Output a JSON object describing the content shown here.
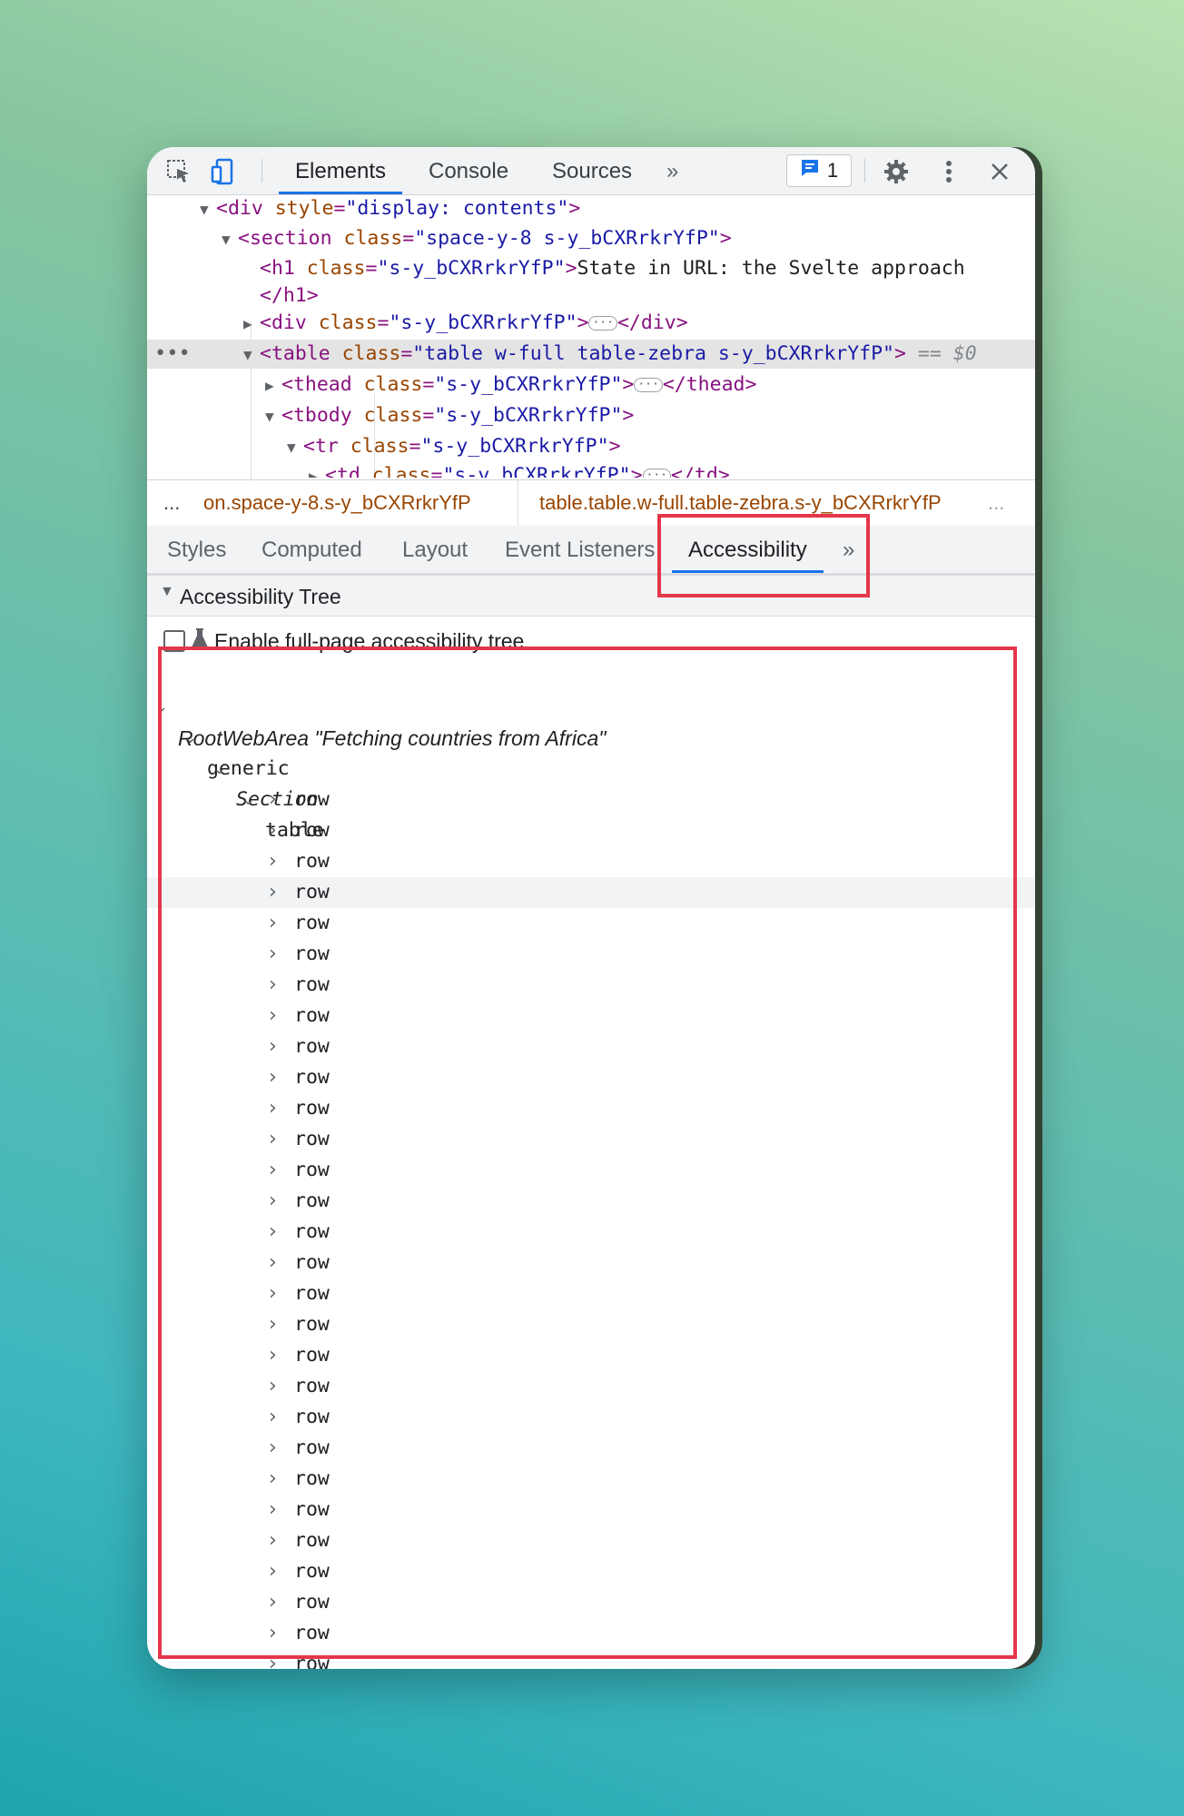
{
  "toolbar": {
    "tabs": [
      {
        "label": "Elements",
        "active": true
      },
      {
        "label": "Console",
        "active": false
      },
      {
        "label": "Sources",
        "active": false
      }
    ],
    "more_tabs_glyph": "»",
    "issues_count": "1",
    "icons": [
      "inspect-element-icon",
      "device-toolbar-icon",
      "issues-message-icon",
      "gear-icon",
      "kebab-menu-icon",
      "close-icon"
    ]
  },
  "dom": {
    "l1": {
      "tag_open": "<div ",
      "attr": "style",
      "val": "\"display: contents\"",
      "close": ">"
    },
    "l2": {
      "tag_open": "<section ",
      "attr": "class",
      "val": "\"space-y-8 s-y_bCXRrkrYfP\"",
      "close": ">"
    },
    "l3": {
      "tag_open": "<h1 ",
      "attr": "class",
      "val": "\"s-y_bCXRrkrYfP\"",
      "close": ">",
      "text": "State in URL: the Svelte approach"
    },
    "l3b": {
      "tag_close": "</h1>"
    },
    "l4": {
      "tag_open": "<div ",
      "attr": "class",
      "val": "\"s-y_bCXRrkrYfP\"",
      "close": ">",
      "ellipsis": "···",
      "end": "</div>"
    },
    "l5": {
      "tag_open": "<table ",
      "attr": "class",
      "val": "\"table w-full table-zebra s-y_bCXRrkrYfP\"",
      "close": ">",
      "eq": "== $0"
    },
    "l6": {
      "tag_open": "<thead ",
      "attr": "class",
      "val": "\"s-y_bCXRrkrYfP\"",
      "close": ">",
      "ellipsis": "···",
      "end": "</thead>"
    },
    "l7": {
      "tag_open": "<tbody ",
      "attr": "class",
      "val": "\"s-y_bCXRrkrYfP\"",
      "close": ">"
    },
    "l8": {
      "tag_open": "<tr ",
      "attr": "class",
      "val": "\"s-y_bCXRrkrYfP\"",
      "close": ">"
    },
    "l9": {
      "tag_open": "<td ",
      "attr": "class",
      "val": "\"s-y_bCXRrkrYfP\"",
      "close": ">",
      "ellipsis": "···",
      "end": "</td>"
    },
    "row_dots": "•••"
  },
  "breadcrumbs": {
    "left_dots": "...",
    "items": [
      "on.space-y-8.s-y_bCXRrkrYfP",
      "table.table.w-full.table-zebra.s-y_bCXRrkrYfP"
    ],
    "right_dots": "..."
  },
  "subtabs": [
    {
      "label": "Styles"
    },
    {
      "label": "Computed"
    },
    {
      "label": "Layout"
    },
    {
      "label": "Event Listeners"
    },
    {
      "label": "Accessibility",
      "active": true
    }
  ],
  "subtabs_more": "»",
  "accessibility_tree": {
    "header": "Accessibility Tree",
    "enable_label": "Enable full-page accessibility tree",
    "root": "RootWebArea \"Fetching countries from Africa\"",
    "generic": "generic",
    "section": "Section",
    "table": "table",
    "row_label": "row",
    "row_count_visible": 29
  },
  "colors": {
    "highlight_box": "#e5364a",
    "accent": "#1a73e8"
  }
}
